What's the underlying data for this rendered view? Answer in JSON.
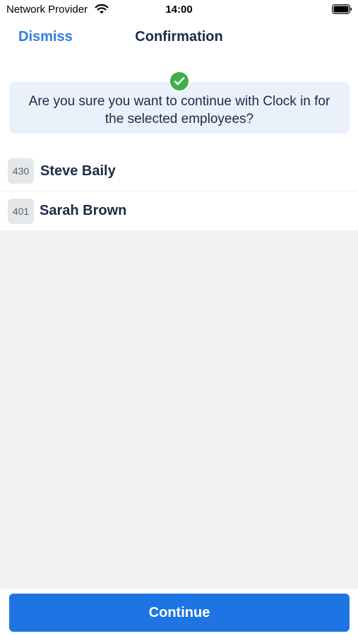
{
  "status_bar": {
    "carrier": "Network Provider",
    "time": "14:00",
    "wifi_icon": "wifi-icon",
    "battery_icon": "battery-full-icon"
  },
  "nav": {
    "dismiss_label": "Dismiss",
    "title": "Confirmation"
  },
  "banner": {
    "icon": "check-circle-icon",
    "icon_color": "#3fae49",
    "message": "Are you sure you want to continue with Clock in for the selected employees?"
  },
  "employees": [
    {
      "id": "430",
      "name": "Steve Baily"
    },
    {
      "id": "401",
      "name": "Sarah Brown"
    }
  ],
  "footer": {
    "continue_label": "Continue"
  },
  "colors": {
    "accent": "#1f74e4",
    "link": "#2f7de1",
    "banner_bg": "#eaf1fb"
  }
}
